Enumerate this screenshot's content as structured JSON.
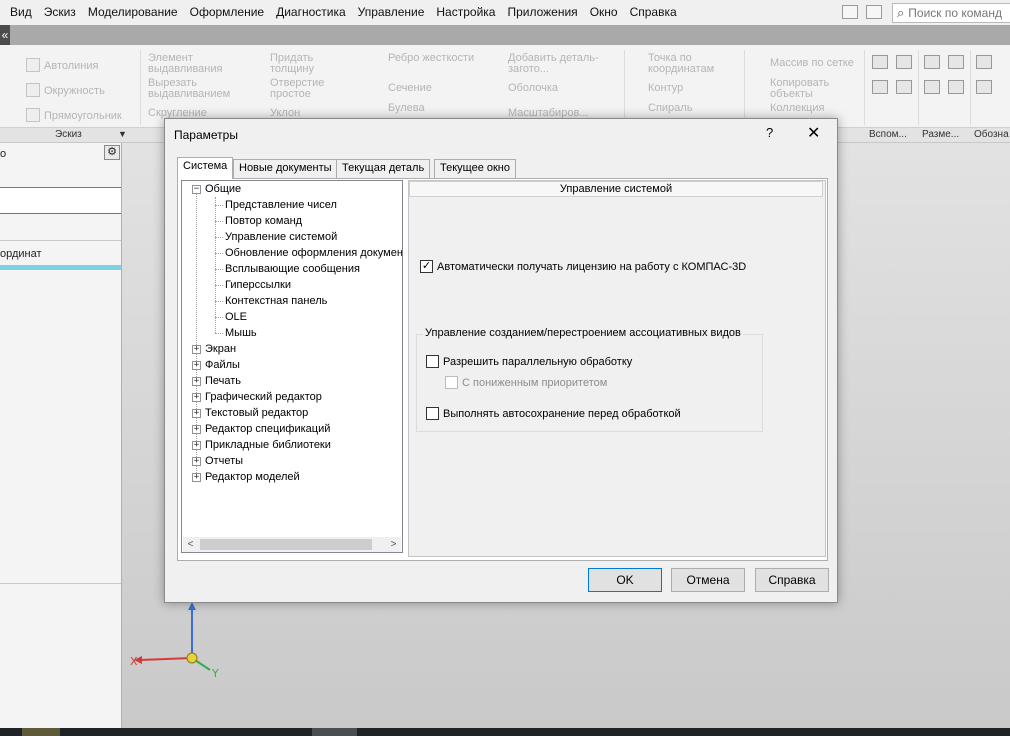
{
  "menubar": {
    "items": [
      "Вид",
      "Эскиз",
      "Моделирование",
      "Оформление",
      "Диагностика",
      "Управление",
      "Настройка",
      "Приложения",
      "Окно",
      "Справка"
    ],
    "search_placeholder": "Поиск по команд"
  },
  "ribbon": {
    "items": [
      "Автолиния",
      "Окружность",
      "Прямоугольник",
      "Элемент выдавливания",
      "Вырезать выдавливанием",
      "Скругление",
      "Придать толщину",
      "Отверстие простое",
      "Уклон",
      "Ребро жесткости",
      "Сечение",
      "Булева",
      "Добавить деталь-загото...",
      "Оболочка",
      "Масштабиров...",
      "Точка по координатам",
      "Контур",
      "Спираль",
      "Массив по сетке",
      "Копировать объекты",
      "Коллекция"
    ],
    "groups": [
      "Эскиз",
      "Вспом...",
      "Разме...",
      "Обозна"
    ]
  },
  "left_panel": {
    "fragment_top": "о",
    "fragment_coords": "ординат"
  },
  "workspace": {
    "axis_x": "X",
    "axis_y": "Y"
  },
  "dialog": {
    "title": "Параметры",
    "help_glyph": "?",
    "close_glyph": "✕",
    "tabs": [
      "Система",
      "Новые документы",
      "Текущая деталь",
      "Текущее окно"
    ],
    "tree": {
      "root": "Общие",
      "children": [
        "Представление чисел",
        "Повтор команд",
        "Управление системой",
        "Обновление оформления документ",
        "Всплывающие сообщения",
        "Гиперссылки",
        "Контекстная панель",
        "OLE",
        "Мышь"
      ],
      "collapsed": [
        "Экран",
        "Файлы",
        "Печать",
        "Графический редактор",
        "Текстовый редактор",
        "Редактор спецификаций",
        "Прикладные библиотеки",
        "Отчеты",
        "Редактор моделей"
      ],
      "selected": "Управление системой"
    },
    "pane_title": "Управление системой",
    "license_checkbox": {
      "label": "Автоматически получать лицензию на работу с КОМПАС-3D",
      "checked": true
    },
    "group_title": "Управление созданием/перестроением ассоциативных видов",
    "parallel_checkbox": {
      "label": "Разрешить параллельную обработку",
      "checked": false
    },
    "low_priority_checkbox": {
      "label": "С пониженным приоритетом",
      "checked": false,
      "disabled": true
    },
    "autosave_checkbox": {
      "label": "Выполнять автосохранение перед обработкой",
      "checked": false
    },
    "buttons": {
      "ok": "OK",
      "cancel": "Отмена",
      "help": "Справка"
    }
  }
}
